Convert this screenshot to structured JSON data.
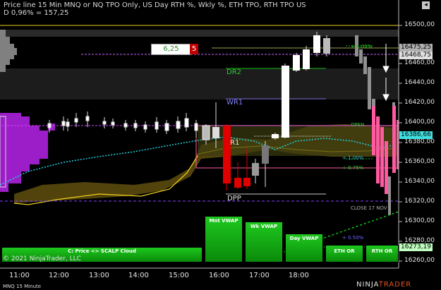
{
  "header": {
    "line1": "Price line 15 Min MNQ or NQ TPO Only, US Day RTH %, Wkly %, ETH TPO, RTH TPO US",
    "line2": "D 0,96% = 157,25"
  },
  "price_box": {
    "value": "6,25",
    "badge": "5"
  },
  "levels": {
    "dr2": "DR2",
    "wr1": "WR1",
    "r1": "R1",
    "dpp": "DPP",
    "open": "OPEN",
    "pct_100": "+ 1.00%",
    "pct_075": "+ 0.75%",
    "pct_050": "+ 0.50%",
    "pct_top": "+ 1.00%",
    "close": "CLOSE 17 NOV"
  },
  "buttons": {
    "mnt_vwap": "Mnt VWAP",
    "wk_vwap": "Wk VWAP",
    "day_vwap": "Day VWAP",
    "cloud": "C: Price <> SCALP Cloud",
    "eth_or": "ETH OR",
    "rth_or": "RTH OR"
  },
  "price_axis": {
    "ticks": [
      "16500,00",
      "16460,00",
      "16440,00",
      "16420,00",
      "16400,00",
      "16380,00",
      "16360,00",
      "16340,00",
      "16320,00",
      "16300,00",
      "16280,00",
      "16260,00"
    ],
    "tags": [
      "16475,25",
      "16468,75",
      "16386,66",
      "16273,19"
    ]
  },
  "time_axis": {
    "ticks": [
      "11:00",
      "12:00",
      "13:00",
      "14:00",
      "15:00",
      "16:00",
      "17:00",
      "18:00"
    ]
  },
  "footer": {
    "copyright": "© 2021 NinjaTrader, LLC",
    "instrument": "MNQ 15 Minute",
    "brand_a": "NINJA",
    "brand_b": "TRADER"
  },
  "colors": {
    "background": "#000000",
    "up_candle": "#ffffff",
    "down_candle": "#e00000",
    "vwap_green": "#12c012",
    "tpo_purple": "#a020d0",
    "cloud": "#6b5a10"
  }
}
